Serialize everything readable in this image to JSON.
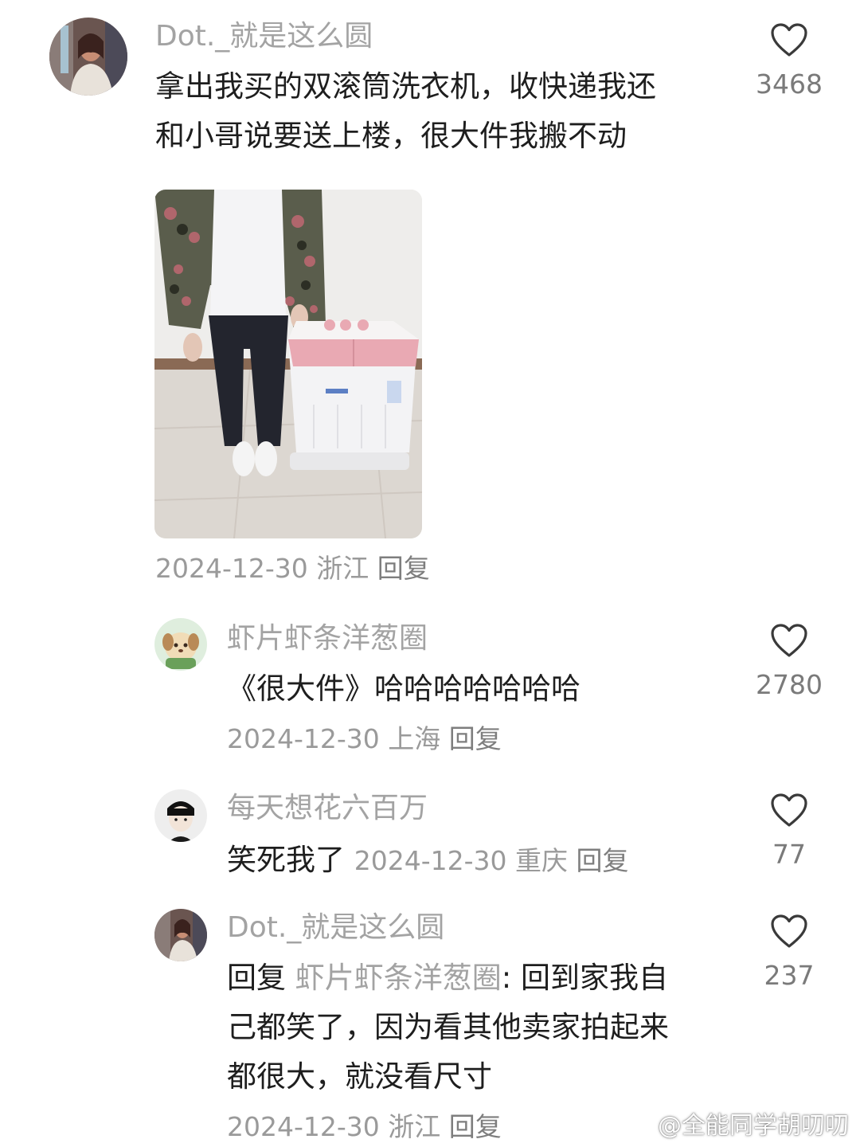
{
  "comments": [
    {
      "username": "Dot._就是这么圆",
      "text_line1": "拿出我买的双滚筒洗衣机，收快递我还",
      "text_line2": "和小哥说要送上楼，很大件我搬不动",
      "date": "2024-12-30",
      "location": "浙江",
      "reply_label": "回复",
      "likes": "3468"
    },
    {
      "username": "虾片虾条洋葱圈",
      "text": "《很大件》哈哈哈哈哈哈哈",
      "date": "2024-12-30",
      "location": "上海",
      "reply_label": "回复",
      "likes": "2780"
    },
    {
      "username": "每天想花六百万",
      "text": "笑死我了",
      "date": "2024-12-30",
      "location": "重庆",
      "reply_label": "回复",
      "likes": "77"
    },
    {
      "username": "Dot._就是这么圆",
      "reply_prefix": "回复",
      "reply_to": "虾片虾条洋葱圈",
      "text_line1": ": 回到家我自",
      "text_line2": "己都笑了，因为看其他卖家拍起来",
      "text_line3": "都很大，就没看尺寸",
      "date": "2024-12-30",
      "location": "浙江",
      "reply_label": "回复",
      "likes": "237"
    }
  ],
  "watermark": "@全能同学胡叨叨",
  "icons": {
    "like": "heart-outline-icon",
    "watermark_logo": "weibo-logo-icon"
  },
  "colors": {
    "username": "#a3a3a3",
    "text": "#1e1e1e",
    "meta": "#9a9a9a",
    "washer_lid": "#e9a9b3"
  }
}
